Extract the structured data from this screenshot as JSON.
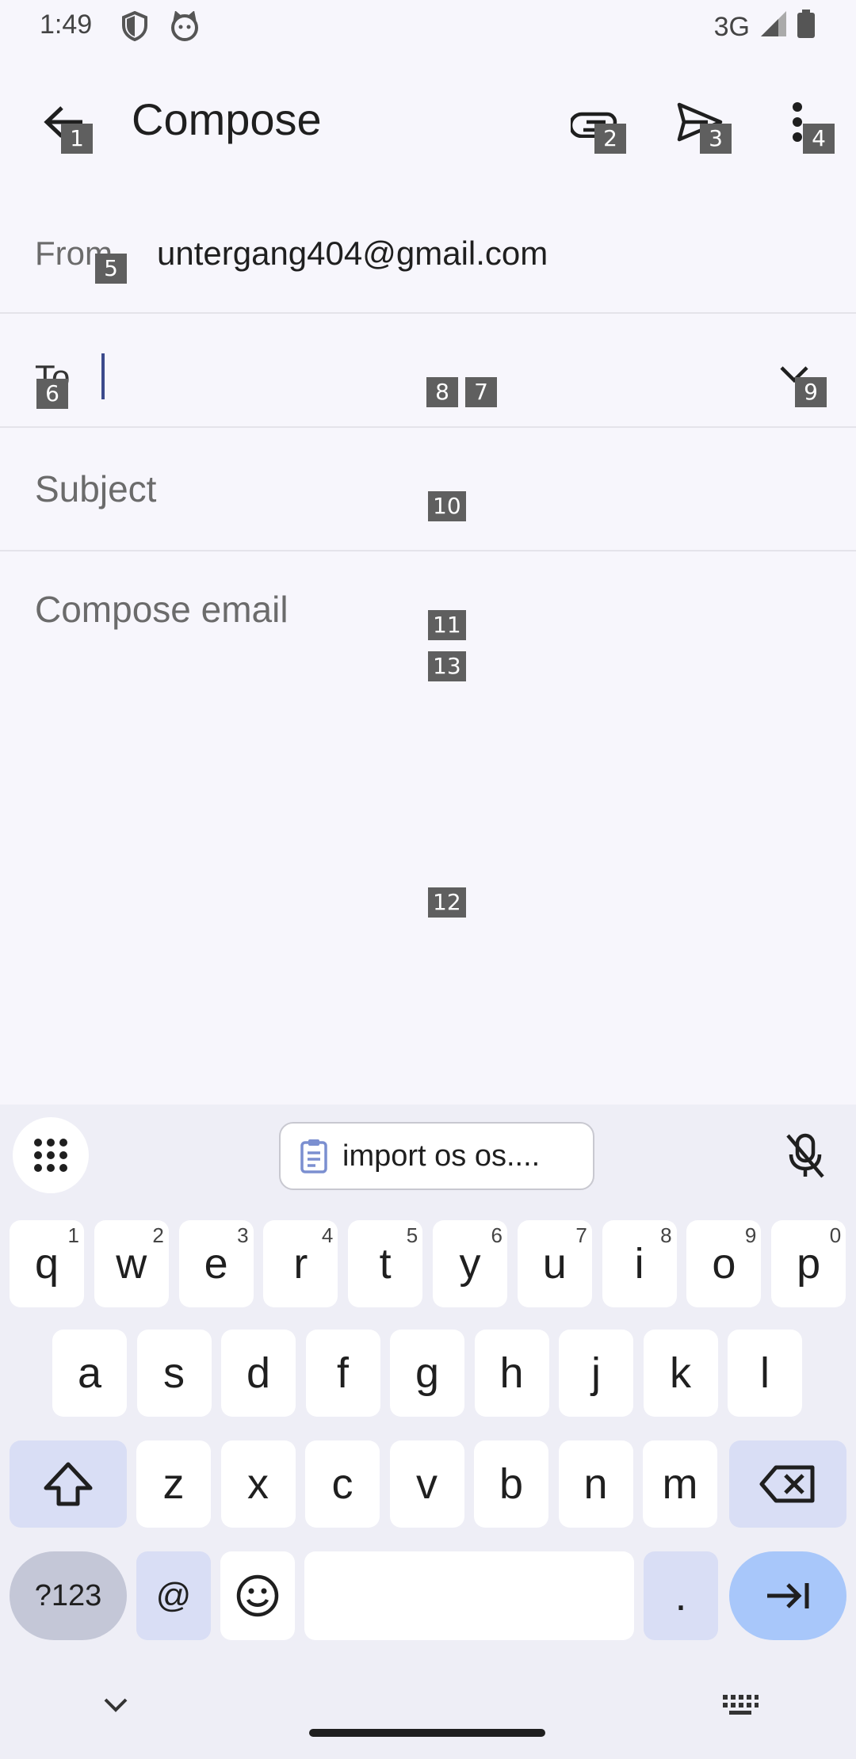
{
  "status_bar": {
    "time": "1:49",
    "network": "3G"
  },
  "app_bar": {
    "title": "Compose"
  },
  "form": {
    "from_label": "From",
    "from_value": "untergang404@gmail.com",
    "to_label": "To",
    "subject_placeholder": "Subject",
    "body_placeholder": "Compose email"
  },
  "overlay_tags": {
    "t1": "1",
    "t2": "2",
    "t3": "3",
    "t4": "4",
    "t5": "5",
    "t6": "6",
    "t7": "7",
    "t8": "8",
    "t9": "9",
    "t10": "10",
    "t11": "11",
    "t12": "12",
    "t13": "13"
  },
  "keyboard": {
    "clipboard_suggestion": "import os os....",
    "row1": [
      {
        "k": "q",
        "h": "1"
      },
      {
        "k": "w",
        "h": "2"
      },
      {
        "k": "e",
        "h": "3"
      },
      {
        "k": "r",
        "h": "4"
      },
      {
        "k": "t",
        "h": "5"
      },
      {
        "k": "y",
        "h": "6"
      },
      {
        "k": "u",
        "h": "7"
      },
      {
        "k": "i",
        "h": "8"
      },
      {
        "k": "o",
        "h": "9"
      },
      {
        "k": "p",
        "h": "0"
      }
    ],
    "row2": [
      "a",
      "s",
      "d",
      "f",
      "g",
      "h",
      "j",
      "k",
      "l"
    ],
    "row3": [
      "z",
      "x",
      "c",
      "v",
      "b",
      "n",
      "m"
    ],
    "symbols_label": "?123",
    "at_label": "@",
    "period_label": "."
  },
  "colors": {
    "accent": "#3c4a8c",
    "enter_key": "#a8c7fa",
    "special_key": "#d9def5"
  }
}
